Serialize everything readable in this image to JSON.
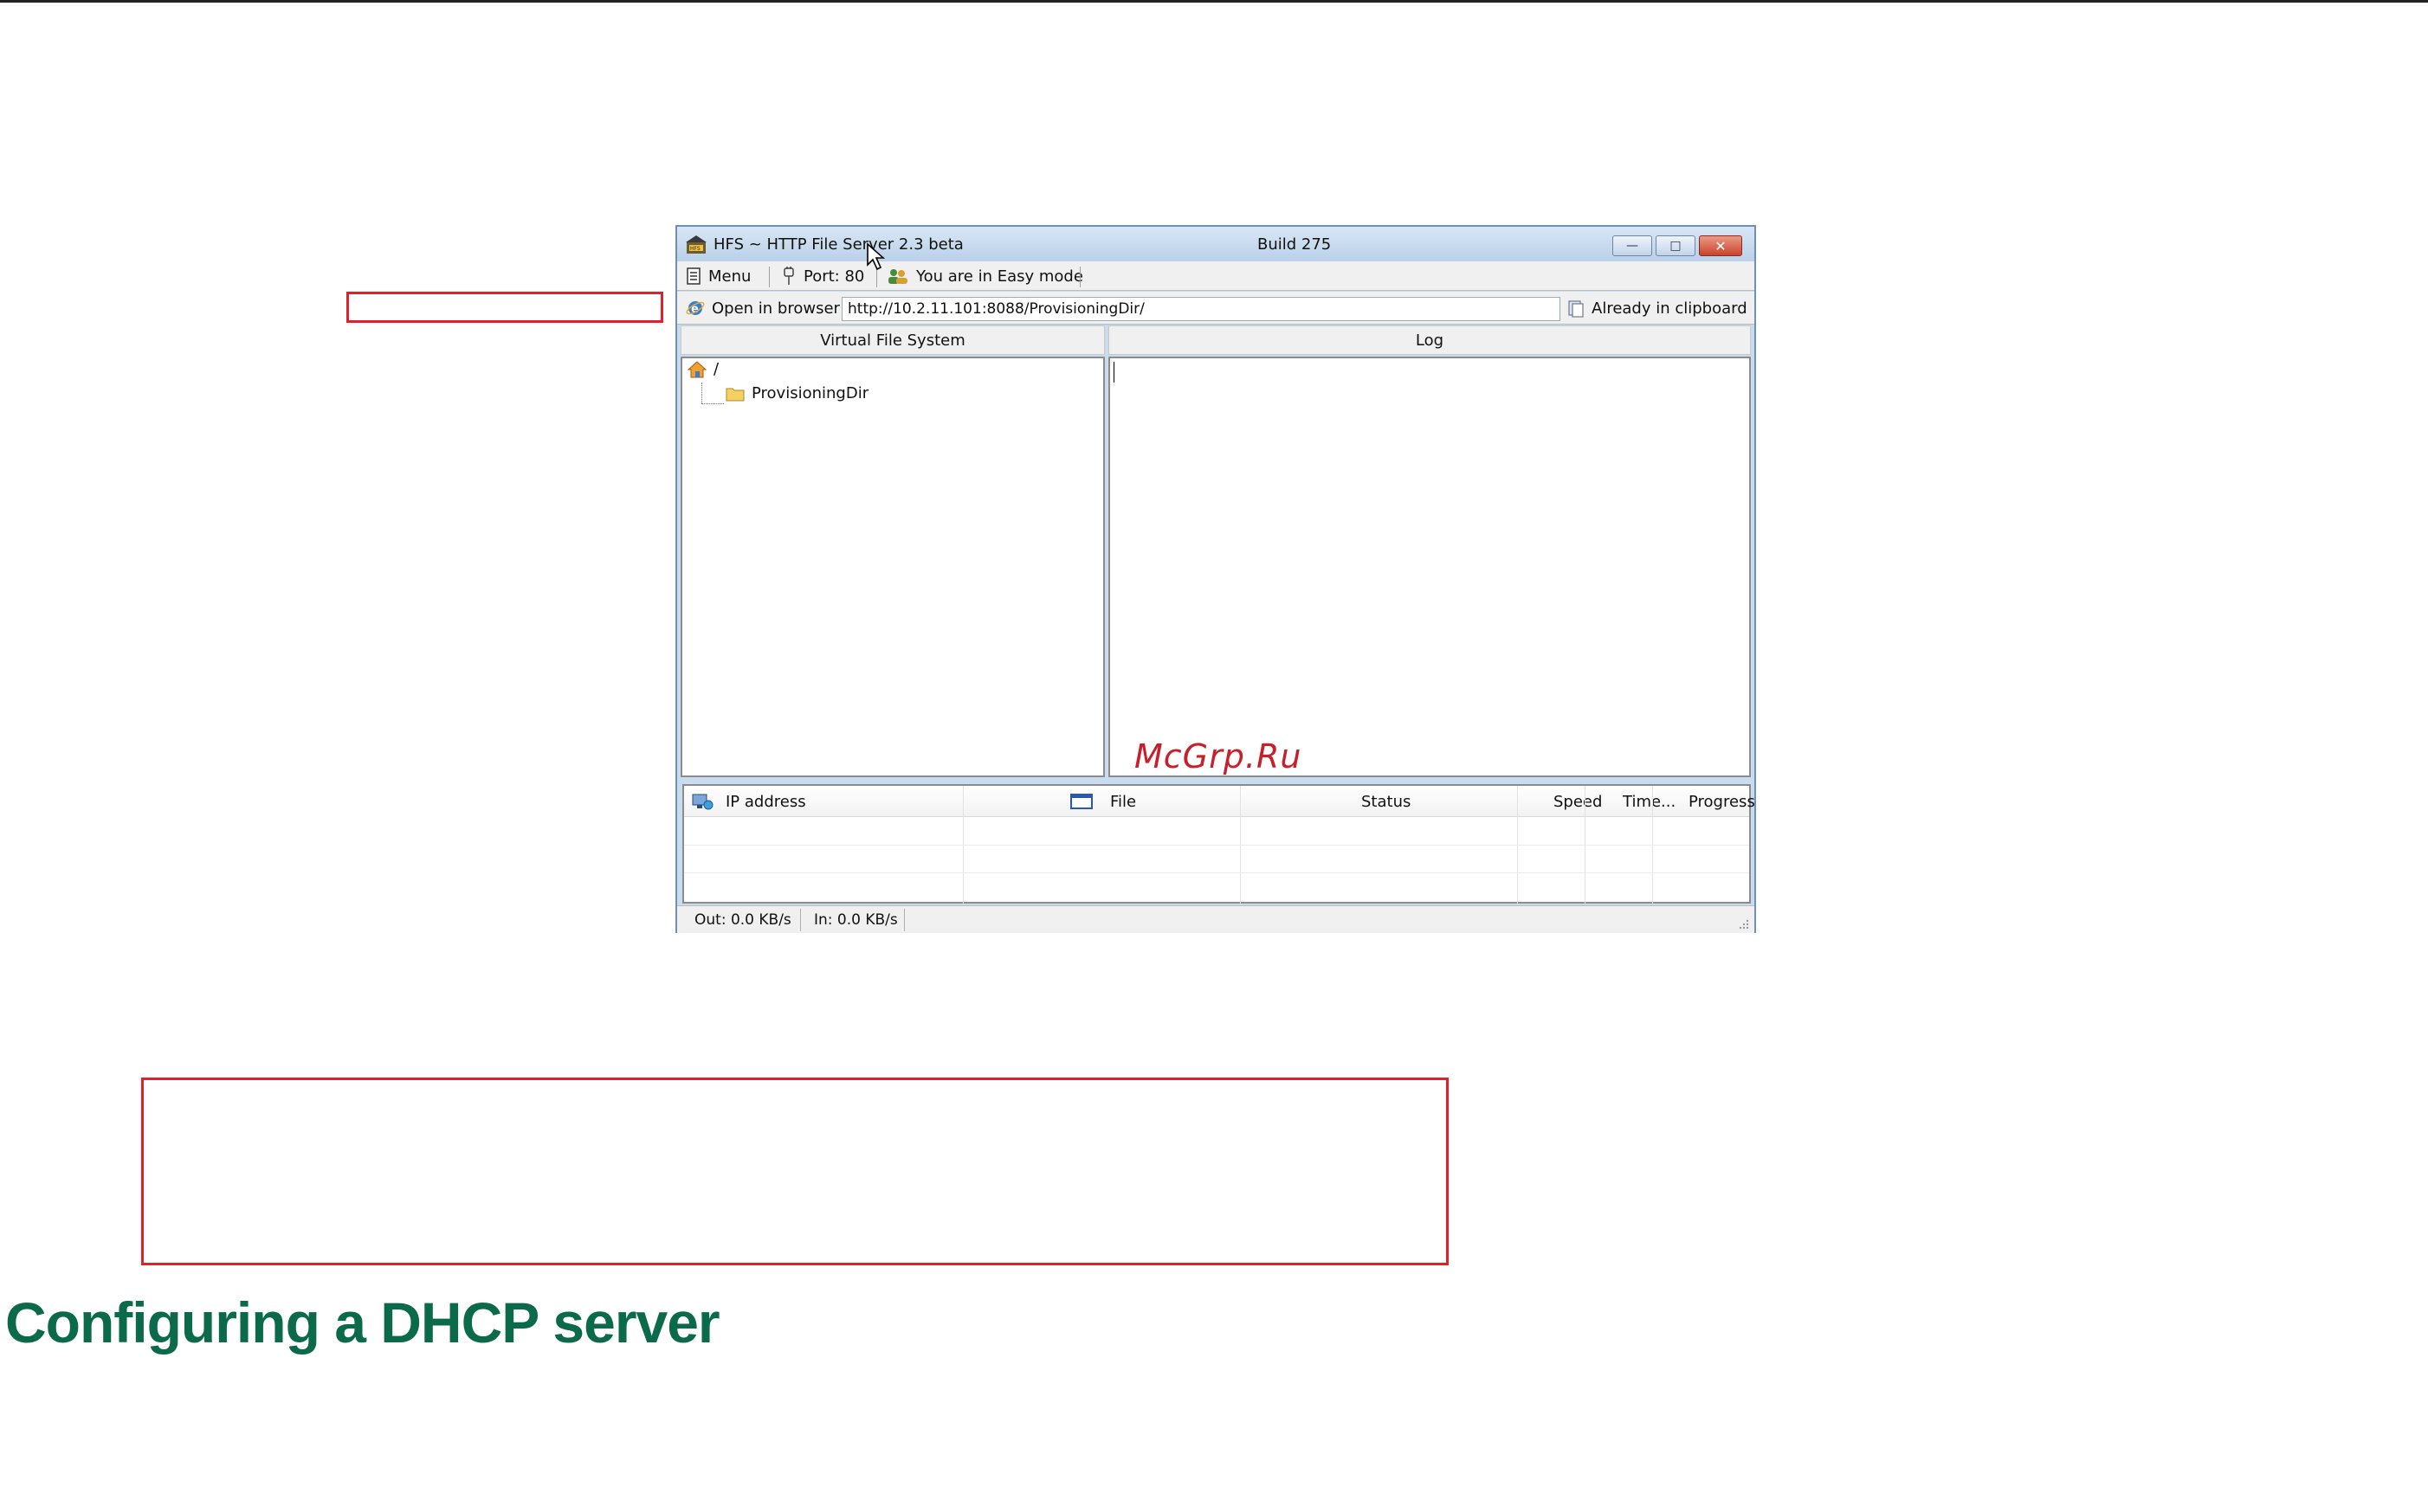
{
  "window": {
    "title": "HFS ~ HTTP File Server 2.3 beta",
    "build": "Build 275"
  },
  "toolbar": {
    "menu": "Menu",
    "port": "Port: 80",
    "mode": "You are in Easy mode"
  },
  "urlbar": {
    "open_in_browser": "Open in browser",
    "url": "http://10.2.11.101:8088/ProvisioningDir/",
    "clipboard": "Already in clipboard"
  },
  "vfs": {
    "header": "Virtual File System",
    "root": "/",
    "items": [
      {
        "label": "ProvisioningDir"
      }
    ]
  },
  "log": {
    "header": "Log"
  },
  "watermark": "McGrp.Ru",
  "connections": {
    "columns": [
      "IP address",
      "File",
      "Status",
      "Speed",
      "Time...",
      "Progress"
    ]
  },
  "statusbar": {
    "out": "Out: 0.0 KB/s",
    "in": "In: 0.0 KB/s"
  },
  "page": {
    "section_title": "Configuring a DHCP server"
  },
  "colors": {
    "accent_red": "#e0202a",
    "title_green": "#0b6a4a",
    "window_frame": "#c9dcee"
  }
}
